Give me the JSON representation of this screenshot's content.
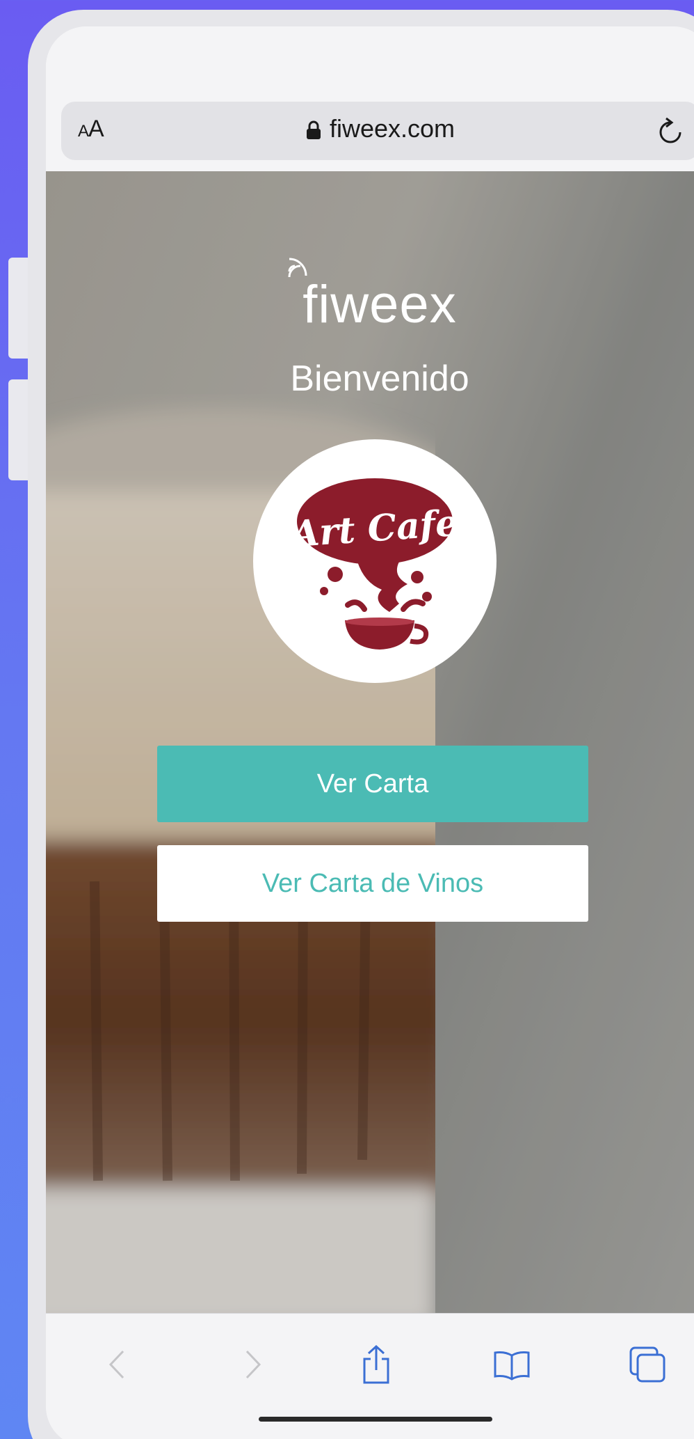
{
  "browser": {
    "aa_label_small": "A",
    "aa_label_large": "A",
    "url": "fiweex.com",
    "lock_icon": "lock-icon",
    "reload_icon": "reload-icon"
  },
  "page": {
    "brand": "fiweex",
    "welcome": "Bienvenido",
    "logo_text": "Art Cafe",
    "primary_button": "Ver Carta",
    "secondary_button": "Ver Carta de Vinos"
  },
  "colors": {
    "accent": "#4bbbb4",
    "logo": "#8c1c2b",
    "background": "#6a5cf2"
  },
  "toolbar": {
    "icons": [
      "back-icon",
      "forward-icon",
      "share-icon",
      "bookmarks-icon",
      "tabs-icon"
    ]
  }
}
